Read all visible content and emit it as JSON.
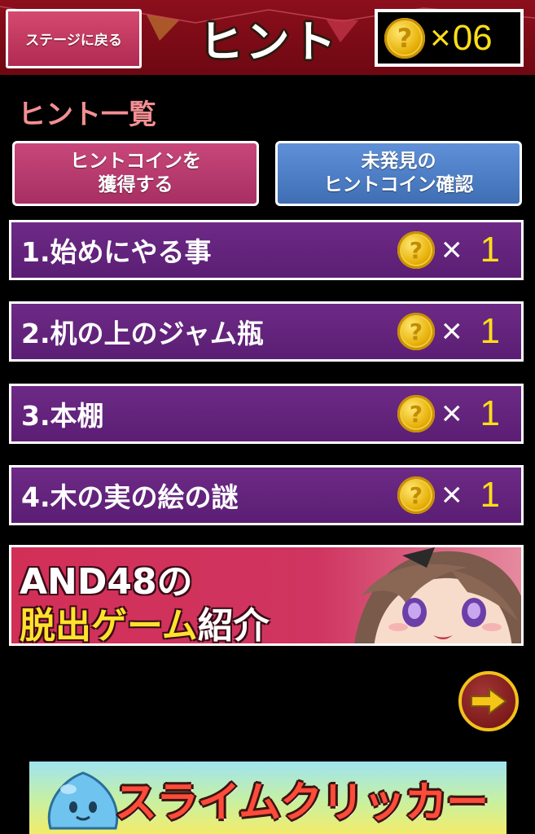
{
  "header": {
    "back_label": "ステージに戻る",
    "title": "ヒント",
    "coin_glyph": "?",
    "coin_times": "×",
    "coin_count": "06"
  },
  "section_heading": "ヒント一覧",
  "actions": {
    "earn_label": "ヒントコインを\n獲得する",
    "check_label": "未発見の\nヒントコイン確認"
  },
  "hints": [
    {
      "label": "1.始めにやる事",
      "times": "×",
      "cost": "1"
    },
    {
      "label": "2.机の上のジャム瓶",
      "times": "×",
      "cost": "1"
    },
    {
      "label": "3.本棚",
      "times": "×",
      "cost": "1"
    },
    {
      "label": "4.木の実の絵の謎",
      "times": "×",
      "cost": "1"
    }
  ],
  "promo": {
    "line1": "AND48の",
    "line2_highlight": "脱出ゲーム",
    "line2_rest": "紹介"
  },
  "banner": {
    "title": "スライムクリッカー"
  },
  "colors": {
    "header_bg": "#8c0f1c",
    "hint_row_bg": "#6d2a86",
    "earn_button": "#c8477a",
    "check_button": "#5f90d8",
    "coin_count": "#ffde17",
    "heading": "#f38f93"
  },
  "icons": {
    "coin": "hint-coin-icon",
    "next": "arrow-right-icon"
  }
}
